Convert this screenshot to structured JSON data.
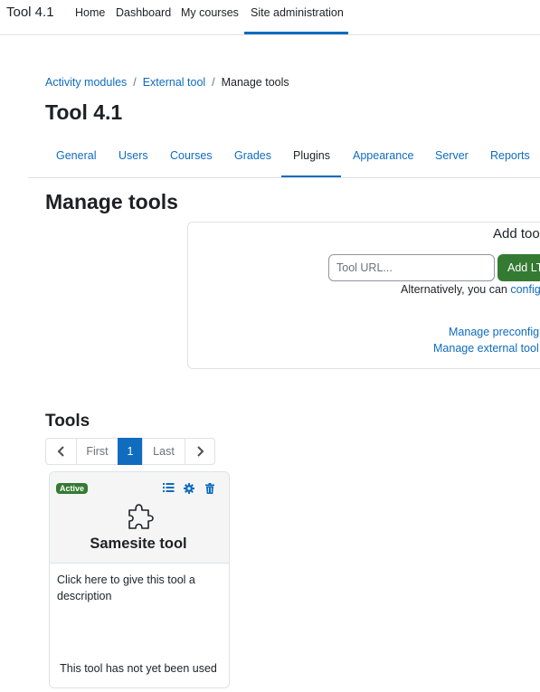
{
  "brand": "Tool 4.1",
  "topnav": {
    "items": [
      "Home",
      "Dashboard",
      "My courses",
      "Site administration"
    ],
    "active": "Site administration"
  },
  "breadcrumb": [
    "Activity modules",
    "External tool",
    "Manage tools"
  ],
  "page_title": "Tool 4.1",
  "admin_tabs": {
    "items": [
      "General",
      "Users",
      "Courses",
      "Grades",
      "Plugins",
      "Appearance",
      "Server",
      "Reports"
    ],
    "active": "Plugins"
  },
  "heading": "Manage tools",
  "add_tool": {
    "title": "Add too",
    "url_placeholder": "Tool URL...",
    "button_label": "Add LT",
    "alt_text": "Alternatively, you can ",
    "alt_link": "configu",
    "manage_preconfig": "Manage preconfigu",
    "manage_external": "Manage external tool"
  },
  "tools_heading": "Tools",
  "pagination": {
    "prev": "‹",
    "first": "First",
    "current": "1",
    "last": "Last",
    "next": "›"
  },
  "tool_card": {
    "status": "Active",
    "name": "Samesite tool",
    "description": "Click here to give this tool a description",
    "usage": "This tool has not yet been used"
  }
}
